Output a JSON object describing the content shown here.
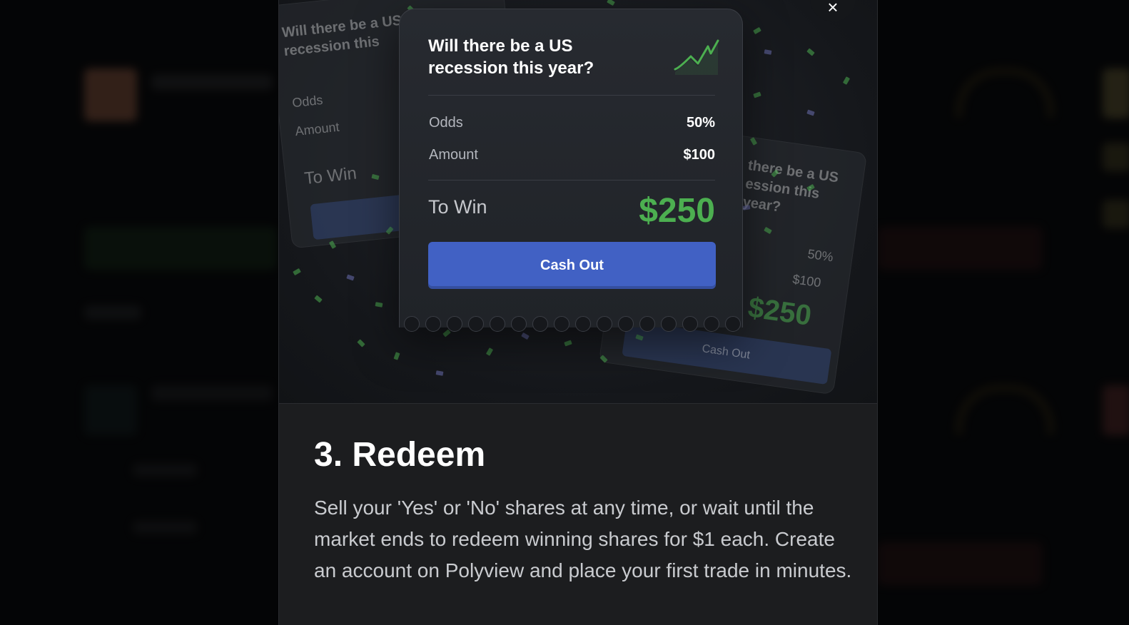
{
  "modal": {
    "close_icon": "×",
    "ticket": {
      "question": "Will there be a US recession this year?",
      "odds_label": "Odds",
      "odds_value": "50%",
      "amount_label": "Amount",
      "amount_value": "$100",
      "to_win_label": "To Win",
      "to_win_value": "$250",
      "button_label": "Cash Out"
    },
    "ghost_left": {
      "question": "Will there be a US recession this",
      "odds_label": "Odds",
      "amount_label": "Amount",
      "to_win_label": "To Win"
    },
    "ghost_right": {
      "question": "there be a US ession this year?",
      "odds_value": "50%",
      "amount_value": "$100",
      "to_win_value": "$250",
      "button_label": "Cash Out"
    },
    "step_heading": "3. Redeem",
    "step_body": "Sell your 'Yes' or 'No' shares at any time, or wait until the market ends to redeem winning shares for $1 each. Create an account on Polyview and place your first trade in minutes."
  },
  "colors": {
    "accent_blue": "#4161c4",
    "win_green": "#4caf50",
    "modal_bg": "#1c1d1f"
  },
  "icons": {
    "trend": "trend-up-icon",
    "close": "close-icon"
  }
}
